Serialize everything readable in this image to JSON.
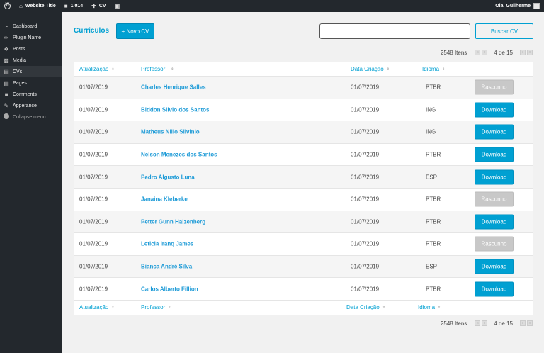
{
  "adminbar": {
    "site_title": "Website Title",
    "comments_count": "1,014",
    "new_label": "CV",
    "greeting": "Ola, Guilherme"
  },
  "sidebar": {
    "items": [
      {
        "label": "Dashboard",
        "icon": "dashboard-icon"
      },
      {
        "label": "Plugin Name",
        "icon": "plugin-icon"
      },
      {
        "label": "Posts",
        "icon": "pin-icon"
      },
      {
        "label": "Media",
        "icon": "media-icon"
      },
      {
        "label": "CVs",
        "icon": "pages-icon",
        "active": true
      },
      {
        "label": "Pages",
        "icon": "pages-icon"
      },
      {
        "label": "Comments",
        "icon": "comment-icon"
      },
      {
        "label": "Apperance",
        "icon": "brush-icon"
      },
      {
        "label": "Collapse menu",
        "icon": "collapse-icon"
      }
    ]
  },
  "main": {
    "title": "Curriculos",
    "new_button": "+ Novo CV",
    "search_value": "",
    "search_button": "Buscar CV",
    "pager": {
      "count": "2548 Itens",
      "page": "4 de 15"
    },
    "columns": {
      "atualizacao": "Atualização",
      "professor": "Professor",
      "data_criacao": "Data Criação",
      "idioma": "Idioma"
    },
    "rows": [
      {
        "date": "01/07/2019",
        "professor": "Charles Henrique Salles",
        "created": "01/07/2019",
        "lang": "PTBR",
        "action": "Rascunho",
        "status": "draft"
      },
      {
        "date": "01/07/2019",
        "professor": "Biddon Silvio dos Santos",
        "created": "01/07/2019",
        "lang": "ING",
        "action": "Download",
        "status": "download"
      },
      {
        "date": "01/07/2019",
        "professor": "Matheus Nillo Silvinio",
        "created": "01/07/2019",
        "lang": "ING",
        "action": "Download",
        "status": "download"
      },
      {
        "date": "01/07/2019",
        "professor": "Nelson Menezes dos Santos",
        "created": "01/07/2019",
        "lang": "PTBR",
        "action": "Download",
        "status": "download"
      },
      {
        "date": "01/07/2019",
        "professor": "Pedro Algusto Luna",
        "created": "01/07/2019",
        "lang": "ESP",
        "action": "Download",
        "status": "download"
      },
      {
        "date": "01/07/2019",
        "professor": "Janaina Kleberke",
        "created": "01/07/2019",
        "lang": "PTBR",
        "action": "Rascunho",
        "status": "draft"
      },
      {
        "date": "01/07/2019",
        "professor": "Petter Gunn Haizenberg",
        "created": "01/07/2019",
        "lang": "PTBR",
        "action": "Download",
        "status": "download"
      },
      {
        "date": "01/07/2019",
        "professor": "Leticia Iranq James",
        "created": "01/07/2019",
        "lang": "PTBR",
        "action": "Rascunho",
        "status": "draft"
      },
      {
        "date": "01/07/2019",
        "professor": "Bianca André Silva",
        "created": "01/07/2019",
        "lang": "ESP",
        "action": "Download",
        "status": "download"
      },
      {
        "date": "01/07/2019",
        "professor": "Carlos Alberto Fillion",
        "created": "01/07/2019",
        "lang": "PTBR",
        "action": "Download",
        "status": "download"
      }
    ]
  },
  "colors": {
    "accent": "#00a0d2",
    "adminbar": "#23282d",
    "draft": "#c8c8c8"
  }
}
